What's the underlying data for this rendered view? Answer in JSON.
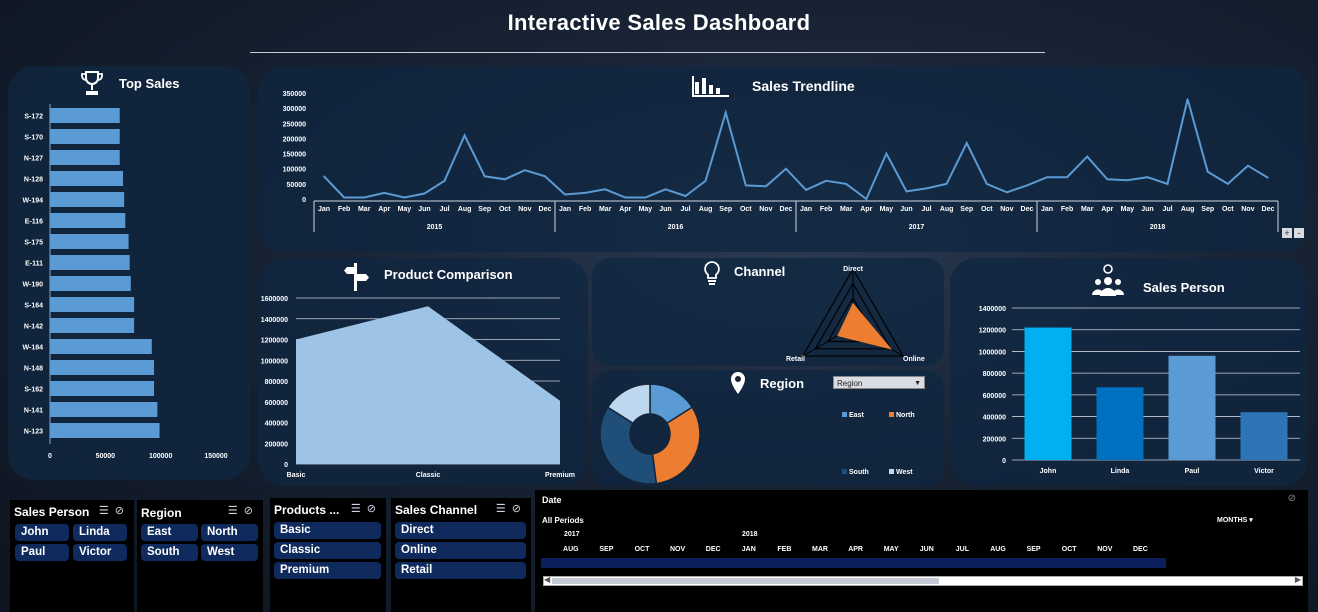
{
  "title": "Interactive Sales Dashboard",
  "colors": {
    "accent_blue": "#5b9bd5",
    "orange": "#ed7d31",
    "light_blue": "#9dc3e6",
    "navy": "#1f4e79",
    "john": "#00b0f0",
    "linda": "#0070c0",
    "victor": "#2e75b6"
  },
  "top_sales": {
    "title": "Top Sales",
    "icon": "trophy-icon",
    "chart_data": {
      "type": "bar",
      "orientation": "horizontal",
      "categories": [
        "S-172",
        "S-170",
        "N-127",
        "N-128",
        "W-194",
        "E-116",
        "S-175",
        "E-111",
        "W-190",
        "S-164",
        "N-142",
        "W-184",
        "N-148",
        "S-162",
        "N-141",
        "N-123"
      ],
      "values": [
        63000,
        63000,
        63000,
        66000,
        67000,
        68000,
        71000,
        72000,
        73000,
        76000,
        76000,
        92000,
        94000,
        94000,
        97000,
        99000
      ],
      "x_ticks": [
        "0",
        "50000",
        "100000",
        "150000"
      ],
      "xlim": [
        0,
        150000
      ]
    }
  },
  "trend": {
    "title": "Sales Trendline",
    "icon": "bar-chart-icon",
    "chart_data": {
      "type": "line",
      "months": [
        "Jan",
        "Feb",
        "Mar",
        "Apr",
        "May",
        "Jun",
        "Jul",
        "Aug",
        "Sep",
        "Oct",
        "Nov",
        "Dec"
      ],
      "years": [
        "2015",
        "2016",
        "2017",
        "2018"
      ],
      "values": [
        75000,
        5000,
        5000,
        20000,
        5000,
        18000,
        60000,
        210000,
        75000,
        65000,
        95000,
        75000,
        15000,
        20000,
        32000,
        5000,
        5000,
        32000,
        10000,
        60000,
        285000,
        45000,
        42000,
        100000,
        30000,
        60000,
        50000,
        0,
        150000,
        25000,
        35000,
        50000,
        185000,
        50000,
        22000,
        45000,
        72000,
        72000,
        140000,
        65000,
        62000,
        72000,
        50000,
        330000,
        90000,
        50000,
        110000,
        70000
      ],
      "y_ticks": [
        "0",
        "50000",
        "100000",
        "150000",
        "200000",
        "250000",
        "300000",
        "350000"
      ],
      "ylim": [
        0,
        350000
      ]
    },
    "buttons": {
      "plus": "+",
      "minus": "-"
    }
  },
  "product": {
    "title": "Product Comparison",
    "icon": "signpost-icon",
    "chart_data": {
      "type": "area",
      "categories": [
        "Basic",
        "Classic",
        "Premium"
      ],
      "values": [
        1200000,
        1520000,
        610000
      ],
      "y_ticks": [
        "0",
        "200000",
        "400000",
        "600000",
        "800000",
        "1000000",
        "1200000",
        "1400000",
        "1600000"
      ],
      "ylim": [
        0,
        1600000
      ]
    }
  },
  "channel": {
    "title": "Channel",
    "icon": "lightbulb-icon",
    "chart_data": {
      "type": "radar",
      "axes": [
        "Direct",
        "Online",
        "Retail"
      ],
      "values": [
        0.4,
        0.75,
        0.3
      ]
    }
  },
  "region": {
    "title": "Region",
    "icon": "map-pin-icon",
    "dropdown": "Region",
    "chart_data": {
      "type": "pie",
      "variant": "doughnut",
      "labels": [
        "East",
        "North",
        "South",
        "West"
      ],
      "values": [
        0.16,
        0.32,
        0.36,
        0.16
      ],
      "colors": [
        "#5b9bd5",
        "#ed7d31",
        "#1f4e79",
        "#bdd7ee"
      ]
    }
  },
  "salesperson": {
    "title": "Sales Person",
    "icon": "people-icon",
    "chart_data": {
      "type": "bar",
      "categories": [
        "John",
        "Linda",
        "Paul",
        "Victor"
      ],
      "values": [
        1220000,
        670000,
        960000,
        440000
      ],
      "colors": [
        "#00b0f0",
        "#0070c0",
        "#5b9bd5",
        "#2e75b6"
      ],
      "y_ticks": [
        "0",
        "200000",
        "400000",
        "600000",
        "800000",
        "1000000",
        "1200000",
        "1400000"
      ],
      "ylim": [
        0,
        1400000
      ]
    }
  },
  "slicers": {
    "sales_person": {
      "title": "Sales Person",
      "items": [
        "John",
        "Linda",
        "Paul",
        "Victor"
      ]
    },
    "region": {
      "title": "Region",
      "items": [
        "East",
        "North",
        "South",
        "West"
      ]
    },
    "products": {
      "title": "Products ...",
      "items": [
        "Basic",
        "Classic",
        "Premium"
      ]
    },
    "channel": {
      "title": "Sales Channel",
      "items": [
        "Direct",
        "Online",
        "Retail"
      ]
    }
  },
  "timeline": {
    "title": "Date",
    "period": "All Periods",
    "unit": "MONTHS",
    "years": [
      "2017",
      "2018"
    ],
    "months": [
      "AUG",
      "SEP",
      "OCT",
      "NOV",
      "DEC",
      "JAN",
      "FEB",
      "MAR",
      "APR",
      "MAY",
      "JUN",
      "JUL",
      "AUG",
      "SEP",
      "OCT",
      "NOV",
      "DEC"
    ],
    "scroll_position": 0.52
  }
}
